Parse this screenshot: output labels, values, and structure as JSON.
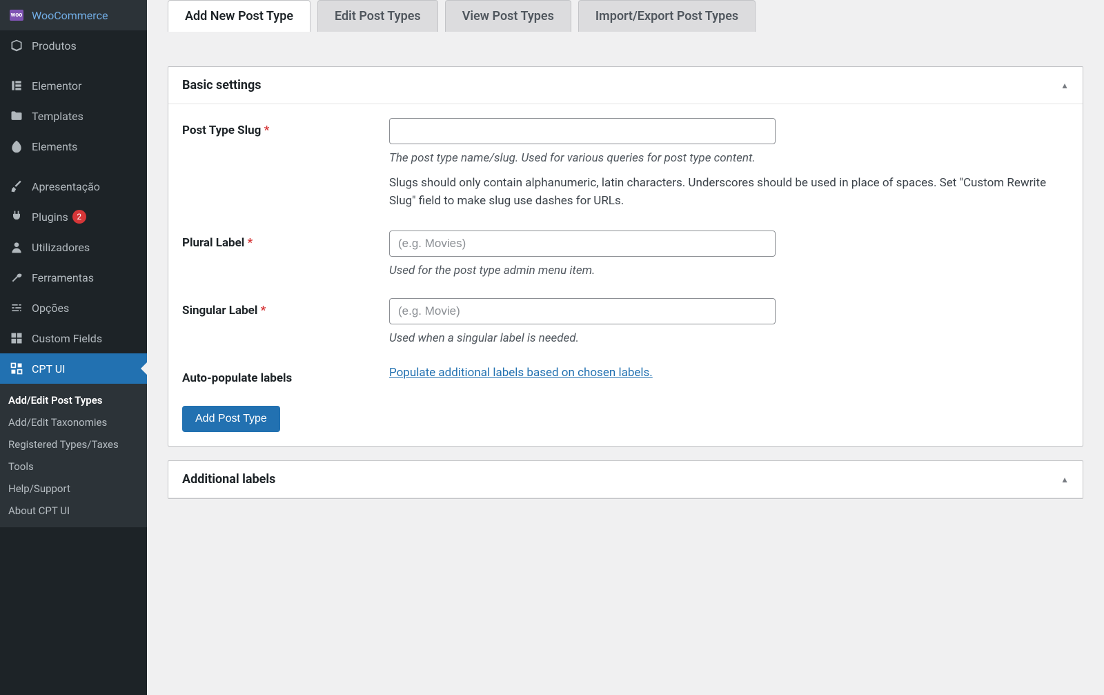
{
  "sidebar": {
    "items": [
      {
        "label": "WooCommerce",
        "icon": "woo"
      },
      {
        "label": "Produtos",
        "icon": "box"
      },
      {
        "label": "Elementor",
        "icon": "elementor"
      },
      {
        "label": "Templates",
        "icon": "folder"
      },
      {
        "label": "Elements",
        "icon": "leaf"
      },
      {
        "label": "Apresentação",
        "icon": "brush"
      },
      {
        "label": "Plugins",
        "icon": "plug",
        "badge": "2"
      },
      {
        "label": "Utilizadores",
        "icon": "user"
      },
      {
        "label": "Ferramentas",
        "icon": "wrench"
      },
      {
        "label": "Opções",
        "icon": "sliders"
      },
      {
        "label": "Custom Fields",
        "icon": "grid"
      },
      {
        "label": "CPT UI",
        "icon": "cpt",
        "active": true
      }
    ],
    "sub": [
      {
        "label": "Add/Edit Post Types",
        "current": true
      },
      {
        "label": "Add/Edit Taxonomies"
      },
      {
        "label": "Registered Types/Taxes"
      },
      {
        "label": "Tools"
      },
      {
        "label": "Help/Support"
      },
      {
        "label": "About CPT UI"
      }
    ]
  },
  "tabs": [
    {
      "label": "Add New Post Type",
      "active": true
    },
    {
      "label": "Edit Post Types"
    },
    {
      "label": "View Post Types"
    },
    {
      "label": "Import/Export Post Types"
    }
  ],
  "panels": {
    "basic": {
      "title": "Basic settings",
      "fields": {
        "slug": {
          "label": "Post Type Slug",
          "required": "*",
          "help_italic": "The post type name/slug. Used for various queries for post type content.",
          "help_text": "Slugs should only contain alphanumeric, latin characters. Underscores should be used in place of spaces. Set \"Custom Rewrite Slug\" field to make slug use dashes for URLs."
        },
        "plural": {
          "label": "Plural Label",
          "required": "*",
          "placeholder": "(e.g. Movies)",
          "help_italic": "Used for the post type admin menu item."
        },
        "singular": {
          "label": "Singular Label",
          "required": "*",
          "placeholder": "(e.g. Movie)",
          "help_italic": "Used when a singular label is needed."
        },
        "autopopulate": {
          "label": "Auto-populate labels",
          "link": "Populate additional labels based on chosen labels."
        }
      },
      "submit": "Add Post Type"
    },
    "additional": {
      "title": "Additional labels"
    }
  }
}
